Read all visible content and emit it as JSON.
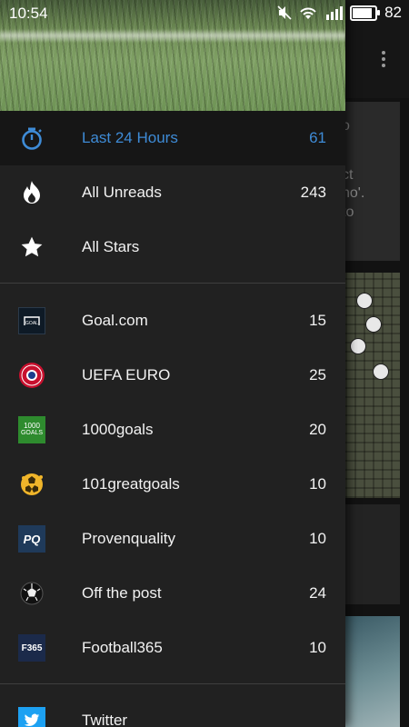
{
  "status_bar": {
    "time": "10:54",
    "battery": "82"
  },
  "drawer": {
    "primary": [
      {
        "label": "Last 24 Hours",
        "count": "61",
        "icon": "stopwatch-icon",
        "active": true
      },
      {
        "label": "All Unreads",
        "count": "243",
        "icon": "flame-icon"
      },
      {
        "label": "All Stars",
        "count": "",
        "icon": "star-icon"
      }
    ],
    "feeds": [
      {
        "label": "Goal.com",
        "count": "15",
        "icon": "goal-logo-icon"
      },
      {
        "label": "UEFA EURO",
        "count": "25",
        "icon": "uefa-logo-icon"
      },
      {
        "label": "1000goals",
        "count": "20",
        "icon": "1000goals-logo-icon"
      },
      {
        "label": "101greatgoals",
        "count": "10",
        "icon": "101greatgoals-logo-icon"
      },
      {
        "label": "Provenquality",
        "count": "10",
        "icon": "provenquality-logo-icon"
      },
      {
        "label": "Off the post",
        "count": "24",
        "icon": "soccer-ball-icon"
      },
      {
        "label": "Football365",
        "count": "10",
        "icon": "football365-logo-icon"
      }
    ],
    "social": [
      {
        "label": "Twitter",
        "count": "",
        "icon": "twitter-icon"
      }
    ]
  },
  "icon_text": {
    "goal": "GOAL",
    "goals1000_top": "1000",
    "goals1000_bottom": "GOALS",
    "pq": "PQ",
    "f365": "F365"
  },
  "background_snippets": [
    "o",
    "ct",
    "no'.",
    "to"
  ],
  "colors": {
    "accent": "#3e8bd6",
    "drawer_bg": "#212121",
    "active_bg": "#161616"
  }
}
